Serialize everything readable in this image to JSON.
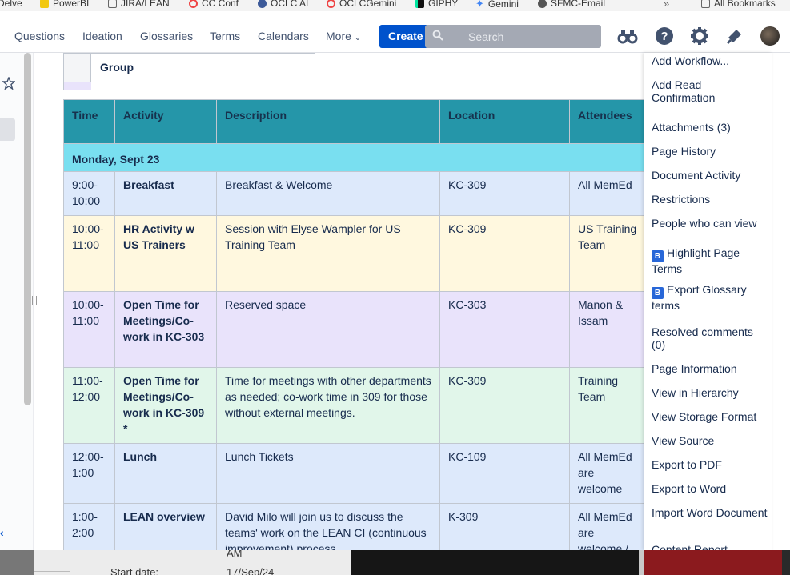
{
  "bookmarks": [
    {
      "label": "Delve",
      "color": "#ffffff"
    },
    {
      "label": "PowerBI",
      "color": "#f2c811"
    },
    {
      "label": "JIRA/LEAN",
      "color": "#ffffff"
    },
    {
      "label": "CC Conf",
      "color": "#ffffff"
    },
    {
      "label": "OCLC AI",
      "color": "#3d5a99"
    },
    {
      "label": "OCLCGemini",
      "color": "#ffffff"
    },
    {
      "label": "GIPHY",
      "color": "#00e6a0"
    },
    {
      "label": "Gemini",
      "color": "#4285f4"
    },
    {
      "label": "SFMC-Email",
      "color": "#555555"
    }
  ],
  "bookmarks_more": "»",
  "all_bookmarks": "All Bookmarks",
  "nav": {
    "questions": "Questions",
    "ideation": "Ideation",
    "glossaries": "Glossaries",
    "terms": "Terms",
    "calendars": "Calendars",
    "more": "More",
    "create": "Create",
    "search_placeholder": "Search"
  },
  "group_header": "Group",
  "table": {
    "columns": [
      "Time",
      "Activity",
      "Description",
      "Location",
      "Attendees"
    ],
    "day": "Monday, Sept 23",
    "rows": [
      {
        "time": "9:00-10:00",
        "activity": "Breakfast",
        "description": "Breakfast & Welcome",
        "location": "KC-309",
        "attendees": "All MemEd",
        "color": "#dde9fb"
      },
      {
        "time": "10:00-11:00",
        "activity": "HR Activity w US Trainers",
        "description": "Session with Elyse Wampler for US Training Team",
        "location": "KC-309",
        "attendees": "US Training Team",
        "color": "#fff8df"
      },
      {
        "time": "10:00-11:00",
        "activity": "Open Time for Meetings/Co-work in KC-303",
        "description": "Reserved space",
        "location": "KC-303",
        "attendees": "Manon & Issam",
        "color": "#e9e3fb"
      },
      {
        "time": "11:00-12:00",
        "activity": "Open Time for Meetings/Co-work in KC-309 *",
        "description": "Time for meetings with other departments as needed; co-work time in 309 for those without external meetings.",
        "location": "KC-309",
        "attendees": "Training Team",
        "color": "#e1f6ea"
      },
      {
        "time": "12:00-1:00",
        "activity": "Lunch",
        "description": "Lunch Tickets",
        "location": "KC-109",
        "attendees": "All MemEd are welcome",
        "color": "#dde9fb"
      },
      {
        "time": "1:00-2:00",
        "activity": "LEAN overview",
        "description": "David Milo will join us to discuss the teams' work on the LEAN CI (continuous improvement) process.",
        "location": "K-309",
        "attendees": "All MemEd are welcome /",
        "color": "#dde9fb"
      }
    ]
  },
  "menu": {
    "add_workflow": "Add Workflow...",
    "add_read_confirmation": "Add Read Confirmation",
    "attachments": "Attachments (3)",
    "page_history": "Page History",
    "document_activity": "Document Activity",
    "restrictions": "Restrictions",
    "people_who_can_view": "People who can view",
    "highlight_page_terms": "Highlight Page Terms",
    "export_glossary_terms": "Export Glossary terms",
    "resolved_comments": "Resolved comments (0)",
    "page_information": "Page Information",
    "view_in_hierarchy": "View in Hierarchy",
    "view_storage_format": "View Storage Format",
    "view_source": "View Source",
    "export_to_pdf": "Export to PDF",
    "export_to_word": "Export to Word",
    "import_word_document": "Import Word Document",
    "content_report": "Content Report",
    "glossary_badge": "B"
  },
  "bottom": {
    "am": "AM",
    "start_date_label": "Start date:",
    "start_date_value": "17/Sep/24"
  },
  "colors": {
    "header_teal": "#2596a9",
    "day_cyan": "#79dff0",
    "create_blue": "#0052cc"
  }
}
